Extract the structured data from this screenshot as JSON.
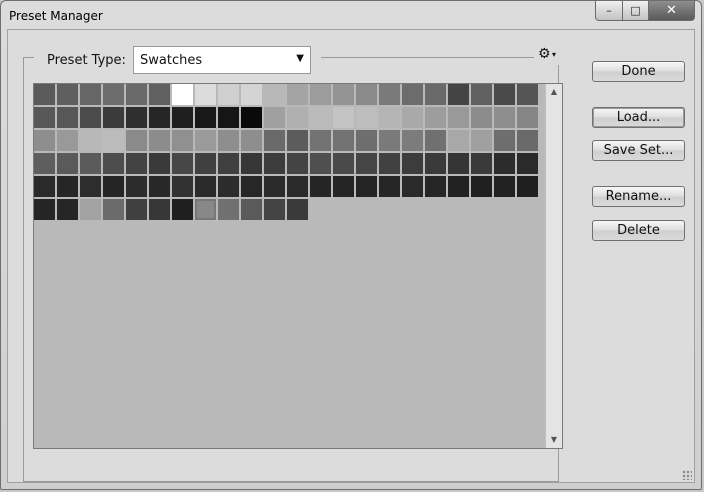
{
  "window": {
    "title": "Preset Manager",
    "controls": {
      "minimize": "–",
      "maximize": "□",
      "close": "✕"
    }
  },
  "preset_type": {
    "label": "Preset Type:",
    "value": "Swatches"
  },
  "buttons": {
    "done": "Done",
    "load": "Load...",
    "save_set": "Save Set...",
    "rename": "Rename...",
    "delete": "Delete"
  },
  "icons": {
    "settings": "gear-icon",
    "dropdown": "chevron-down-icon"
  },
  "swatches": {
    "selected_index": 117,
    "colors": [
      "#5a5a5a",
      "#5f5f5f",
      "#666666",
      "#6d6d6d",
      "#6a6a6a",
      "#606060",
      "#ffffff",
      "#dcdcdc",
      "#cfcfcf",
      "#d4d4d4",
      "#b8b8b8",
      "#a4a4a4",
      "#9c9c9c",
      "#949494",
      "#8a8a8a",
      "#7a7a7a",
      "#6c6c6c",
      "#6a6a6a",
      "#444444",
      "#606060",
      "#4a4a4a",
      "#555555",
      "#585858",
      "#575757",
      "#4b4b4b",
      "#3b3b3b",
      "#2f2f2f",
      "#262626",
      "#1f1f1f",
      "#181818",
      "#151515",
      "#0a0a0a",
      "#a0a0a0",
      "#b0b0b0",
      "#bbbbbb",
      "#c4c4c4",
      "#bebebe",
      "#b5b5b5",
      "#a9a9a9",
      "#9d9d9d",
      "#999999",
      "#8c8c8c",
      "#8e8e8e",
      "#868686",
      "#8e8e8e",
      "#999999",
      "#b8b8b8",
      "#bcbcbc",
      "#8a8a8a",
      "#8c8c8c",
      "#909090",
      "#9b9b9b",
      "#8e8e8e",
      "#8e8e8e",
      "#6a6a6a",
      "#5c5c5c",
      "#727272",
      "#727272",
      "#6e6e6e",
      "#7a7a7a",
      "#7c7c7c",
      "#707070",
      "#a8a8a8",
      "#a0a0a0",
      "#6e6e6e",
      "#6a6a6a",
      "#5e5e5e",
      "#5a5a5a",
      "#5b5b5b",
      "#4d4d4d",
      "#434343",
      "#3a3a3a",
      "#474747",
      "#404040",
      "#3f3f3f",
      "#363636",
      "#3c3c3c",
      "#444444",
      "#4f4f4f",
      "#4a4a4a",
      "#454545",
      "#414141",
      "#3c3c3c",
      "#3a3a3a",
      "#353535",
      "#3a3a3a",
      "#2c2c2c",
      "#2a2a2a",
      "#2a2a2a",
      "#262626",
      "#2d2d2d",
      "#252525",
      "#2c2c2c",
      "#282828",
      "#323232",
      "#2a2a2a",
      "#2c2c2c",
      "#272727",
      "#2b2b2b",
      "#2a2a2a",
      "#252525",
      "#242424",
      "#242424",
      "#262626",
      "#2a2a2a",
      "#262626",
      "#222222",
      "#202020",
      "#222222",
      "#1f1f1f",
      "#252525",
      "#262626",
      "#a2a2a2",
      "#6b6b6b",
      "#404040",
      "#373737",
      "#1f1f1f",
      "#888888",
      "#707070",
      "#5a5a5a",
      "#444444",
      "#3a3a3a"
    ]
  }
}
